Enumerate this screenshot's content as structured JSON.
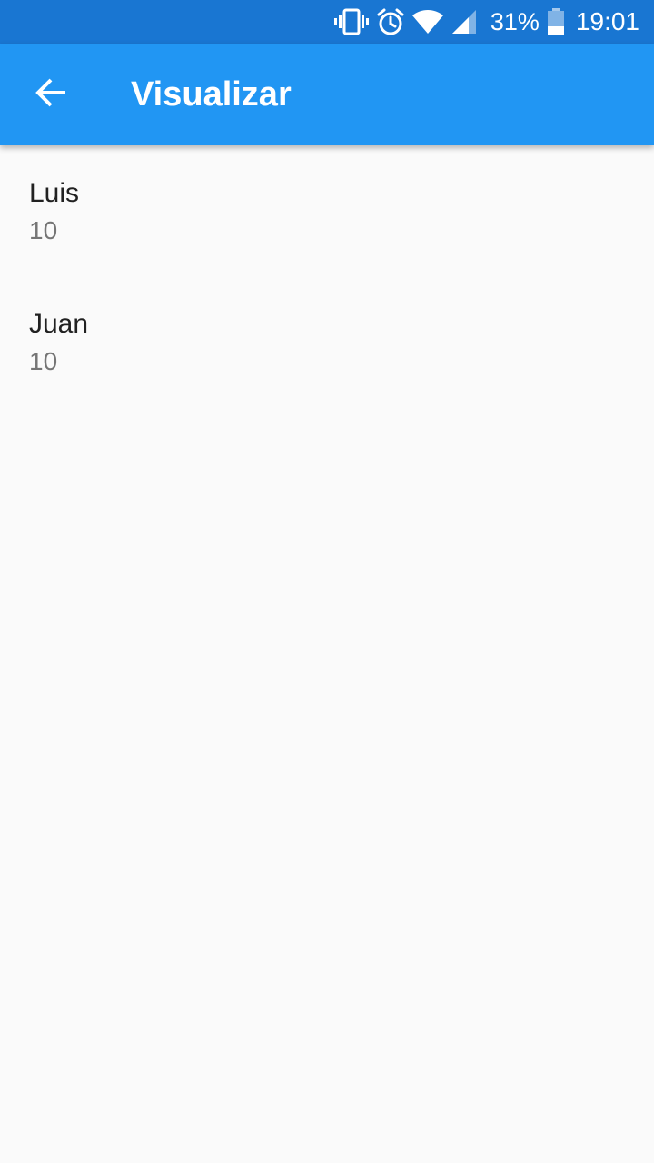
{
  "status_bar": {
    "battery_percent": "31%",
    "time": "19:01",
    "icons": [
      "vibrate-icon",
      "alarm-icon",
      "wifi-icon",
      "cell-signal-icon",
      "battery-icon"
    ],
    "background_color": "#1976d2"
  },
  "app_bar": {
    "title": "Visualizar",
    "back_icon": "arrow-back-icon",
    "background_color": "#2196f3"
  },
  "list": {
    "items": [
      {
        "title": "Luis",
        "subtitle": "10"
      },
      {
        "title": "Juan",
        "subtitle": "10"
      }
    ]
  }
}
